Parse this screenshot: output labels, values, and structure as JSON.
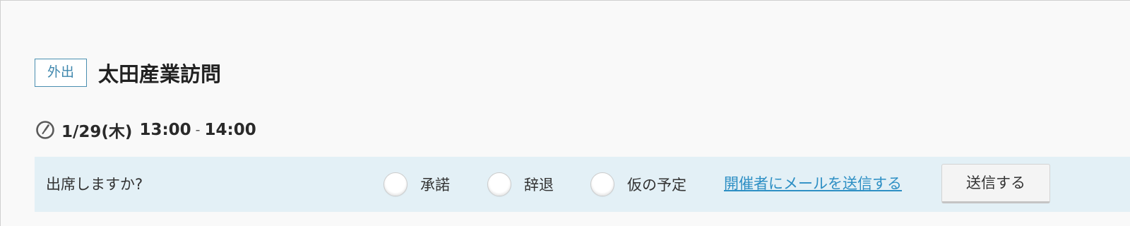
{
  "event": {
    "category": "外出",
    "title": "太田産業訪問",
    "date": "1/29(木)",
    "start_time": "13:00",
    "separator": "-",
    "end_time": "14:00"
  },
  "rsvp": {
    "question": "出席しますか?",
    "options": [
      {
        "label": "承諾",
        "selected": false
      },
      {
        "label": "辞退",
        "selected": false
      },
      {
        "label": "仮の予定",
        "selected": false
      }
    ],
    "mail_link": "開催者にメールを送信する",
    "send_button": "送信する"
  },
  "icons": {
    "clock": "clock-icon"
  },
  "colors": {
    "accent": "#3f87ad",
    "link": "#2d8fc4",
    "rsvp_background": "#e3f0f6",
    "panel_background": "#f9f9f9"
  }
}
